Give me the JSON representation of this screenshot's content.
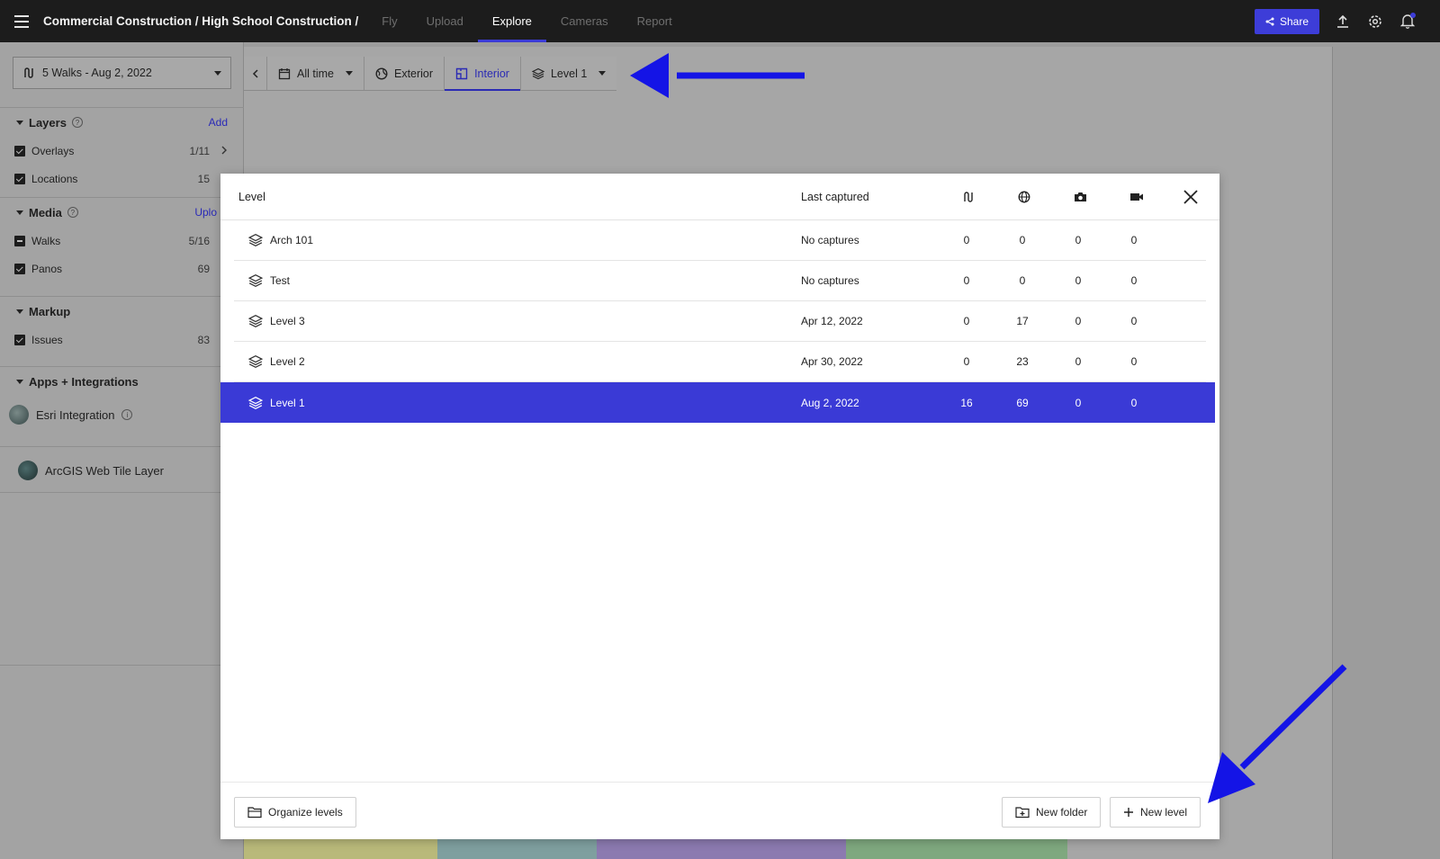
{
  "topbar": {
    "breadcrumb": "Commercial Construction / High School Construction /",
    "tabs": [
      "Fly",
      "Upload",
      "Explore",
      "Cameras",
      "Report"
    ],
    "active_tab": "Explore",
    "share_label": "Share"
  },
  "sidebar": {
    "walk_select": "5 Walks - Aug 2, 2022",
    "layers": {
      "title": "Layers",
      "action": "Add",
      "items": [
        {
          "label": "Overlays",
          "count": "1/11"
        },
        {
          "label": "Locations",
          "count": "15"
        }
      ]
    },
    "media": {
      "title": "Media",
      "action": "Uplo",
      "items": [
        {
          "label": "Walks",
          "count": "5/16"
        },
        {
          "label": "Panos",
          "count": "69"
        }
      ]
    },
    "markup": {
      "title": "Markup",
      "items": [
        {
          "label": "Issues",
          "count": "83"
        }
      ]
    },
    "apps": {
      "title": "Apps + Integrations",
      "items": [
        {
          "label": "Esri Integration"
        }
      ]
    },
    "arcgis_label": "ArcGIS Web Tile Layer"
  },
  "toolbar": {
    "time": "All time",
    "exterior": "Exterior",
    "interior": "Interior",
    "level": "Level 1"
  },
  "modal": {
    "headers": {
      "level": "Level",
      "last_captured": "Last captured"
    },
    "rows": [
      {
        "name": "Arch 101",
        "last": "No captures",
        "walks": "0",
        "panos": "0",
        "photos": "0",
        "videos": "0"
      },
      {
        "name": "Test",
        "last": "No captures",
        "walks": "0",
        "panos": "0",
        "photos": "0",
        "videos": "0"
      },
      {
        "name": "Level 3",
        "last": "Apr 12, 2022",
        "walks": "0",
        "panos": "17",
        "photos": "0",
        "videos": "0"
      },
      {
        "name": "Level 2",
        "last": "Apr 30, 2022",
        "walks": "0",
        "panos": "23",
        "photos": "0",
        "videos": "0"
      },
      {
        "name": "Level 1",
        "last": "Aug 2, 2022",
        "walks": "16",
        "panos": "69",
        "photos": "0",
        "videos": "0"
      }
    ],
    "selected_row": "Level 1",
    "footer": {
      "organize": "Organize levels",
      "new_folder": "New folder",
      "new_level": "New level"
    }
  },
  "colors": {
    "accent": "#3a3ad6",
    "annotation_arrow": "#1414e6",
    "topbar": "#1c1c1c"
  }
}
